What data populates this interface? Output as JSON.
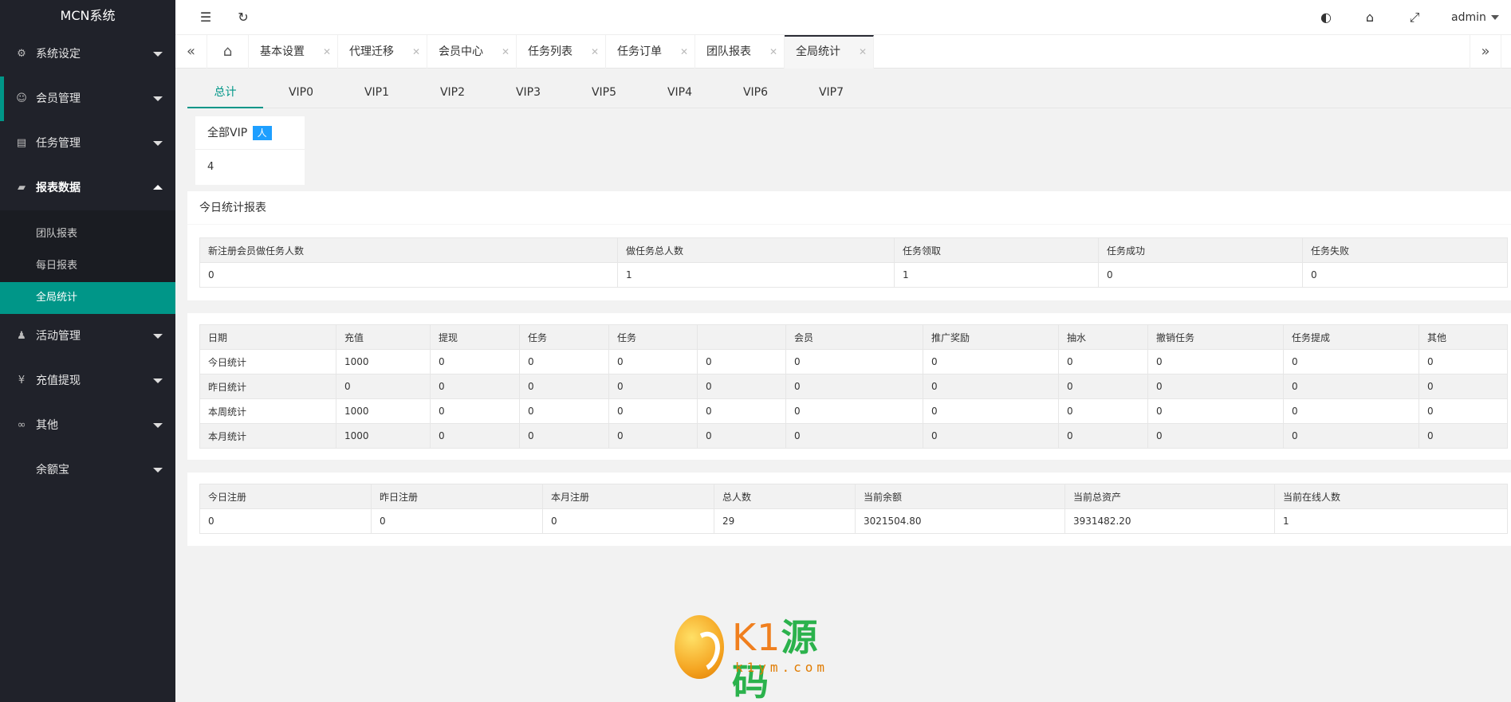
{
  "app": {
    "title": "MCN系统"
  },
  "sidebar": {
    "items": [
      {
        "label": "系统设定",
        "icon": "gear-icon"
      },
      {
        "label": "会员管理",
        "icon": "user-icon"
      },
      {
        "label": "任务管理",
        "icon": "document-icon"
      },
      {
        "label": "报表数据",
        "icon": "monitor-icon"
      },
      {
        "label": "活动管理",
        "icon": "activity-icon"
      },
      {
        "label": "充值提现",
        "icon": "yen-icon"
      },
      {
        "label": "其他",
        "icon": "link-icon"
      },
      {
        "label": "余额宝",
        "icon": ""
      }
    ],
    "subitems": [
      "团队报表",
      "每日报表",
      "全局统计"
    ]
  },
  "header": {
    "user": "admin"
  },
  "tabs": [
    "基本设置",
    "代理迁移",
    "会员中心",
    "任务列表",
    "任务订单",
    "团队报表",
    "全局统计"
  ],
  "levels": [
    "总计",
    "VIP0",
    "VIP1",
    "VIP2",
    "VIP3",
    "VIP5",
    "VIP4",
    "VIP6",
    "VIP7"
  ],
  "vip_card": {
    "label": "全部VIP",
    "badge": "人",
    "value": "4"
  },
  "today_report": {
    "title": "今日统计报表",
    "headers": [
      "新注册会员做任务人数",
      "做任务总人数",
      "任务领取",
      "任务成功",
      "任务失败"
    ],
    "row": [
      "0",
      "1",
      "1",
      "0",
      "0"
    ]
  },
  "period_stats": {
    "headers": [
      "日期",
      "充值",
      "提现",
      "任务",
      "任务",
      "",
      "会员",
      "推广奖励",
      "抽水",
      "撤销任务",
      "任务提成",
      "其他"
    ],
    "rows": [
      [
        "今日统计",
        "1000",
        "0",
        "0",
        "0",
        "0",
        "0",
        "0",
        "0",
        "0",
        "0",
        "0"
      ],
      [
        "昨日统计",
        "0",
        "0",
        "0",
        "0",
        "0",
        "0",
        "0",
        "0",
        "0",
        "0",
        "0"
      ],
      [
        "本周统计",
        "1000",
        "0",
        "0",
        "0",
        "0",
        "0",
        "0",
        "0",
        "0",
        "0",
        "0"
      ],
      [
        "本月统计",
        "1000",
        "0",
        "0",
        "0",
        "0",
        "0",
        "0",
        "0",
        "0",
        "0",
        "0"
      ]
    ]
  },
  "totals": {
    "headers": [
      "今日注册",
      "昨日注册",
      "本月注册",
      "总人数",
      "当前余额",
      "当前总资产",
      "当前在线人数"
    ],
    "row": [
      "0",
      "0",
      "0",
      "29",
      "3021504.80",
      "3931482.20",
      "1"
    ]
  },
  "watermark": {
    "brand_a": "K1",
    "brand_b": "源码",
    "url": "k1ym.com"
  },
  "colors": {
    "sidebar_bg": "#20222a",
    "accent": "#009688",
    "badge": "#1e9fff"
  }
}
